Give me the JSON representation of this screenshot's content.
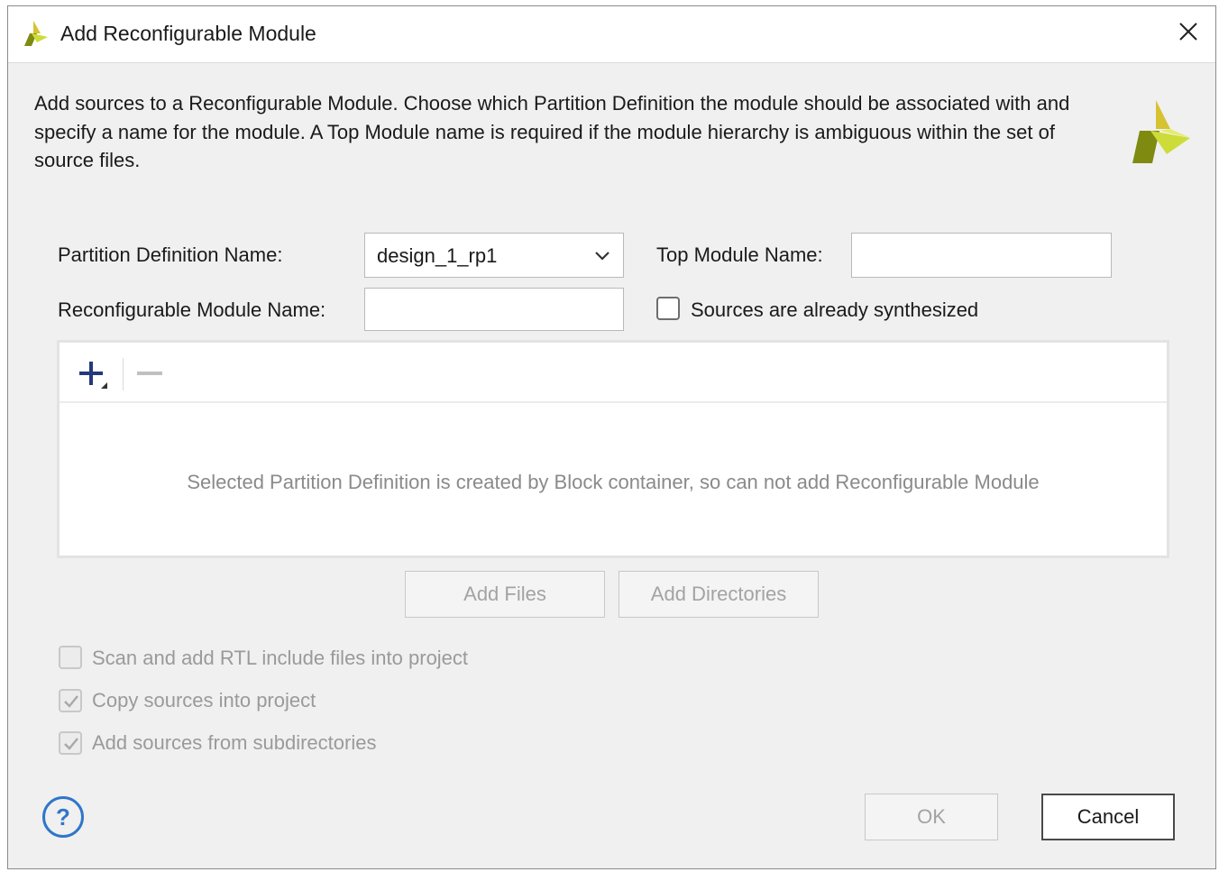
{
  "window": {
    "title": "Add Reconfigurable Module",
    "icons": {
      "app": "xilinx-logo-icon",
      "close": "close-icon"
    }
  },
  "description": "Add sources to a Reconfigurable Module. Choose which Partition Definition the module should be associated with and specify a name for the module. A Top Module name is required if the module hierarchy is ambiguous within the set of source files.",
  "form": {
    "partition_label": "Partition Definition Name:",
    "partition_value": "design_1_rp1",
    "top_module_label": "Top Module Name:",
    "top_module_value": "",
    "rm_name_label": "Reconfigurable Module Name:",
    "rm_name_value": "",
    "synth_checkbox_label": "Sources are already synthesized",
    "synth_checked": false
  },
  "sources_panel": {
    "message": "Selected Partition Definition is created by Block container, so can not add Reconfigurable Module",
    "icons": {
      "add": "plus-icon",
      "remove": "minus-icon"
    }
  },
  "buttons": {
    "add_files": "Add Files",
    "add_directories": "Add Directories",
    "ok": "OK",
    "cancel": "Cancel",
    "help": "?"
  },
  "options": [
    {
      "label": "Scan and add RTL include files into project",
      "checked": false
    },
    {
      "label": "Copy sources into project",
      "checked": true
    },
    {
      "label": "Add sources from subdirectories",
      "checked": true
    }
  ],
  "colors": {
    "logo_dark": "#7f8a10",
    "logo_light": "#cddc39",
    "accent_blue": "#2f76c8"
  }
}
